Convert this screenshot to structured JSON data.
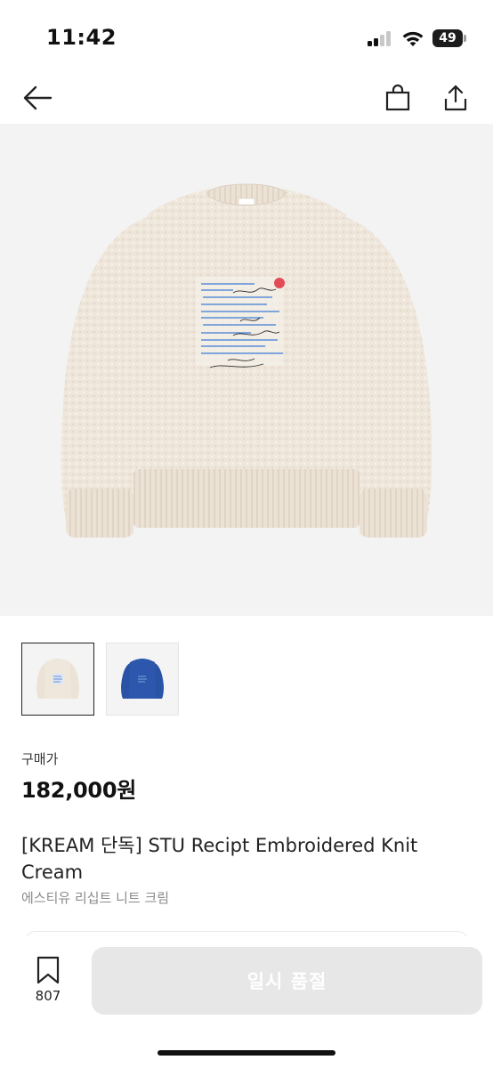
{
  "status_bar": {
    "time": "11:42",
    "battery": "49",
    "battery_level": 0.49,
    "signal_bars_active": 2,
    "signal_bars_total": 4
  },
  "nav": {
    "back_icon": "arrow-left-icon",
    "bag_icon": "shopping-bag-icon",
    "share_icon": "share-icon"
  },
  "product": {
    "image_colors": [
      "#efe6da",
      "#2c55a8"
    ],
    "price_label": "구매가",
    "price": "182,000원",
    "title": "[KREAM 단독] STU Recipt Embroidered Knit Cream",
    "subtitle": "에스티유 리십트 니트 크림"
  },
  "bottom_bar": {
    "wish_icon": "bookmark-icon",
    "wish_count": "807",
    "soldout_label": "일시 품절"
  }
}
